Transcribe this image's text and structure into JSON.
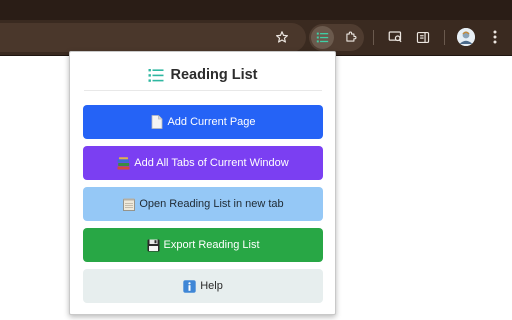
{
  "browser": {
    "colors": {
      "frame": "#2a1d16",
      "toolbar": "#3a2a20"
    },
    "toolbar_icons": [
      "star-icon",
      "reading-list-extension-icon",
      "extensions-puzzle-icon",
      "media-controls-icon",
      "side-panel-icon",
      "profile-avatar",
      "more-menu-icon"
    ]
  },
  "popup": {
    "title": "Reading List",
    "title_icon": "list-icon",
    "buttons": [
      {
        "id": "add-current",
        "label": "Add Current Page",
        "icon": "document-icon",
        "color": "#2563f6"
      },
      {
        "id": "add-all",
        "label": "Add All Tabs of Current Window",
        "icon": "books-icon",
        "color": "#7b3ff2"
      },
      {
        "id": "open",
        "label": "Open Reading List in new tab",
        "icon": "notepad-icon",
        "color": "#95c8f6"
      },
      {
        "id": "export",
        "label": "Export Reading List",
        "icon": "floppy-disk-icon",
        "color": "#28a745"
      },
      {
        "id": "help",
        "label": "Help",
        "icon": "info-icon",
        "color": "#e7eeee"
      }
    ]
  }
}
